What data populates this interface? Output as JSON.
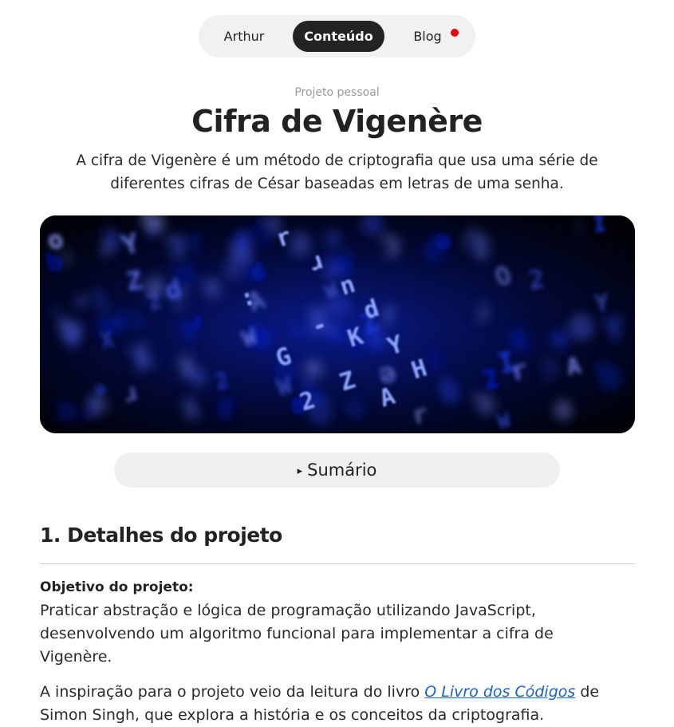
{
  "nav": {
    "items": [
      {
        "label": "Arthur"
      },
      {
        "label": "Conteúdo"
      },
      {
        "label": "Blog"
      }
    ],
    "notification_color": "#ee0000"
  },
  "header": {
    "eyebrow": "Projeto pessoal",
    "title": "Cifra de Vigenère",
    "lead": "A cifra de Vigenère é um método de criptografia que usa uma série de diferentes cifras de César baseadas em letras de uma senha."
  },
  "hero": {
    "glyphs": [
      "r",
      "o",
      "Z",
      "W",
      "ɹ",
      "n",
      "d",
      "ɔ",
      ":",
      "-",
      "K",
      "Y",
      "G",
      "H",
      "ə",
      "Z",
      "I",
      "O",
      "X",
      "b",
      "2",
      "A"
    ],
    "accent": "#1a3cff"
  },
  "summary": {
    "marker": "▸",
    "label": "Sumário"
  },
  "section1": {
    "heading": "1. Detalhes do projeto",
    "objective_label": "Objetivo do projeto:",
    "objective_text": "Praticar abstração e lógica de programação utilizando JavaScript, desenvolvendo um algoritmo funcional para implementar a cifra de Vigenère.",
    "inspiration_before": "A inspiração para o projeto veio da leitura do livro ",
    "inspiration_link": "O Livro dos Códigos",
    "inspiration_after": " de Simon Singh, que explora a história e os conceitos da criptografia."
  }
}
